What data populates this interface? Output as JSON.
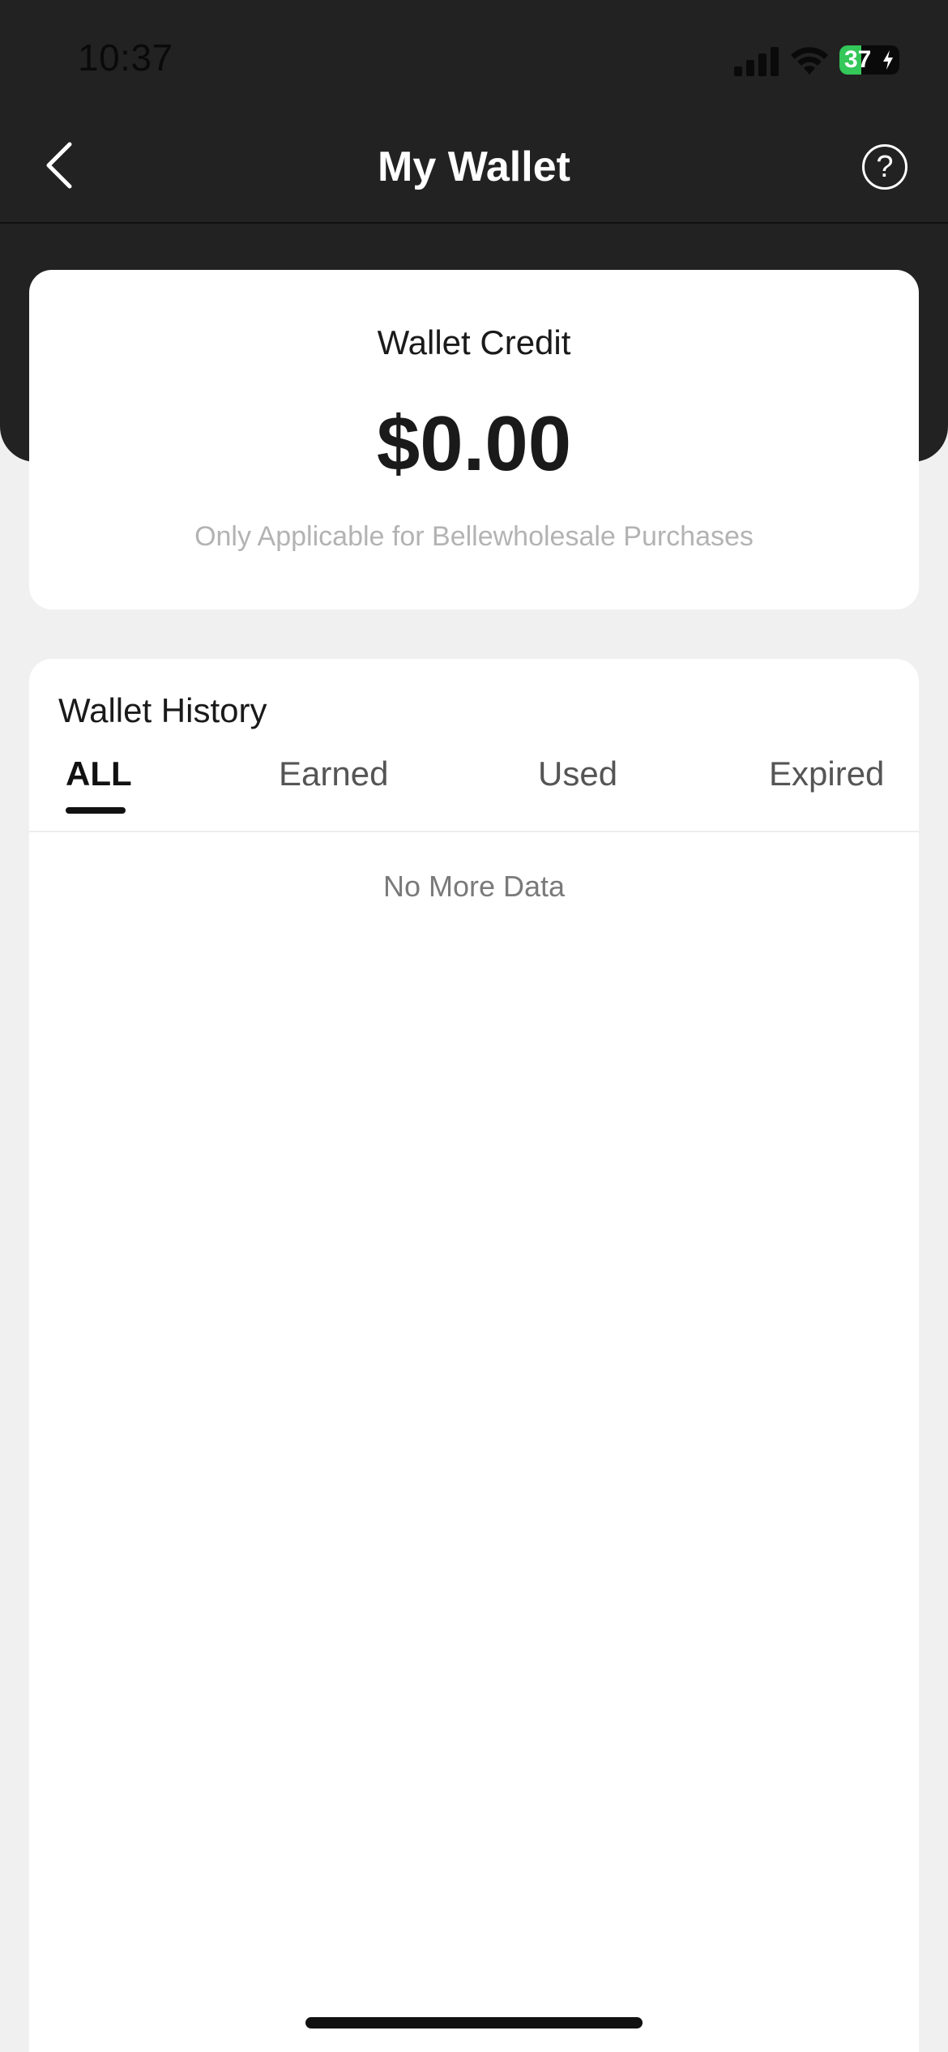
{
  "status_bar": {
    "time": "10:37",
    "battery_percent": "37",
    "battery_level": 0.37,
    "icons": [
      "signal-icon",
      "wifi-icon",
      "battery-charging-icon"
    ]
  },
  "nav": {
    "title": "My Wallet",
    "back_icon": "chevron-left-icon",
    "help_icon": "question-circle-icon",
    "help_glyph": "?"
  },
  "credit": {
    "title": "Wallet Credit",
    "amount": "$0.00",
    "note": "Only Applicable for Bellewholesale Purchases"
  },
  "history": {
    "title": "Wallet History",
    "tabs": [
      {
        "label": "ALL",
        "active": true
      },
      {
        "label": "Earned",
        "active": false
      },
      {
        "label": "Used",
        "active": false
      },
      {
        "label": "Expired",
        "active": false
      }
    ],
    "empty_text": "No More Data"
  },
  "colors": {
    "header_bg": "#222222",
    "page_bg": "#f0f0f0",
    "card_bg": "#ffffff",
    "battery_green": "#34c759"
  }
}
